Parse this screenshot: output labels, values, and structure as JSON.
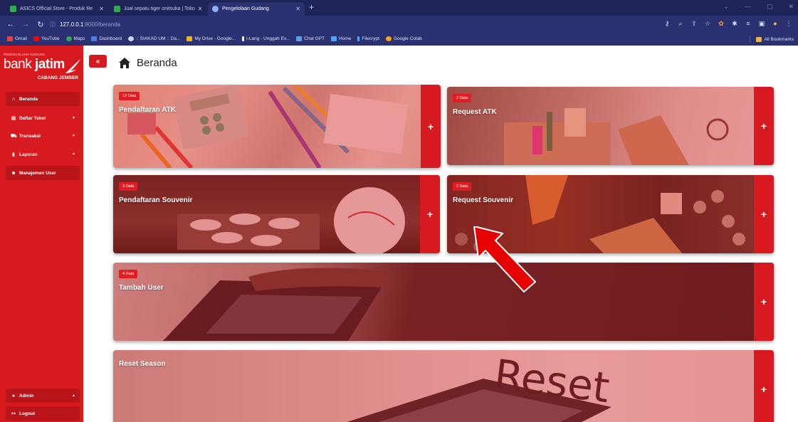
{
  "browser": {
    "tabs": [
      {
        "title": "ASICS Official Store - Produk Re",
        "favicon_color": "#36a852"
      },
      {
        "title": "Jual sepatu tiger onitsuka | Toko",
        "favicon_color": "#36a852"
      },
      {
        "title": "Pengelolaan Gudang",
        "favicon_color": "#8ab4f8"
      }
    ],
    "url_host": "127.0.0.1",
    "url_path": ":8000/beranda",
    "bookmarks": [
      {
        "label": "Gmail",
        "color": "#ea4335"
      },
      {
        "label": "YouTube",
        "color": "#ff0000"
      },
      {
        "label": "Maps",
        "color": "#34a853"
      },
      {
        "label": "Dashboard",
        "color": "#4a7be8"
      },
      {
        "label": ":: SIAKAD UM :: Da...",
        "color": "#cfd3e8"
      },
      {
        "label": "My Drive - Google...",
        "color": "#f4b400"
      },
      {
        "label": "i-Lang - Unggah Ev...",
        "color": "#ffffff"
      },
      {
        "label": "Chat GPT",
        "color": "#5aa0e6"
      },
      {
        "label": "Home",
        "color": "#3fa9f5"
      },
      {
        "label": "Filecrypt",
        "color": "#3fa9f5"
      },
      {
        "label": "Google Colab",
        "color": "#f9ab00"
      }
    ],
    "all_bookmarks": "All Bookmarks"
  },
  "brand": {
    "small": "PENGELOLAAN GUDANG",
    "name_light": "bank ",
    "name_bold": "jatim",
    "branch": "CABANG JEMBER"
  },
  "sidebar": {
    "items": [
      {
        "label": "Beranda",
        "icon": "home-icon"
      },
      {
        "label": "Daftar Tabel",
        "icon": "table-icon"
      },
      {
        "label": "Transaksi",
        "icon": "cart-icon"
      },
      {
        "label": "Laporan",
        "icon": "file-icon"
      },
      {
        "label": "Manajemen User",
        "icon": "users-icon"
      }
    ],
    "user": "Admin",
    "logout": "Logout"
  },
  "page": {
    "title": "Beranda"
  },
  "cards": [
    {
      "badge": "13 Data",
      "label": "Pendaftaran ATK"
    },
    {
      "badge": "2 Data",
      "label": "Request ATK"
    },
    {
      "badge": "3 Data",
      "label": "Pendaftaran Souvenir"
    },
    {
      "badge": "2 Data",
      "label": "Request Souvenir"
    },
    {
      "badge": "4 Data",
      "label": "Tambah User"
    },
    {
      "label": "Reset Season",
      "bg_text": "Reset"
    }
  ],
  "card_action": "+",
  "colors": {
    "brand_red": "#d71920",
    "chrome_dark": "#1e2457",
    "chrome": "#2b3170"
  }
}
